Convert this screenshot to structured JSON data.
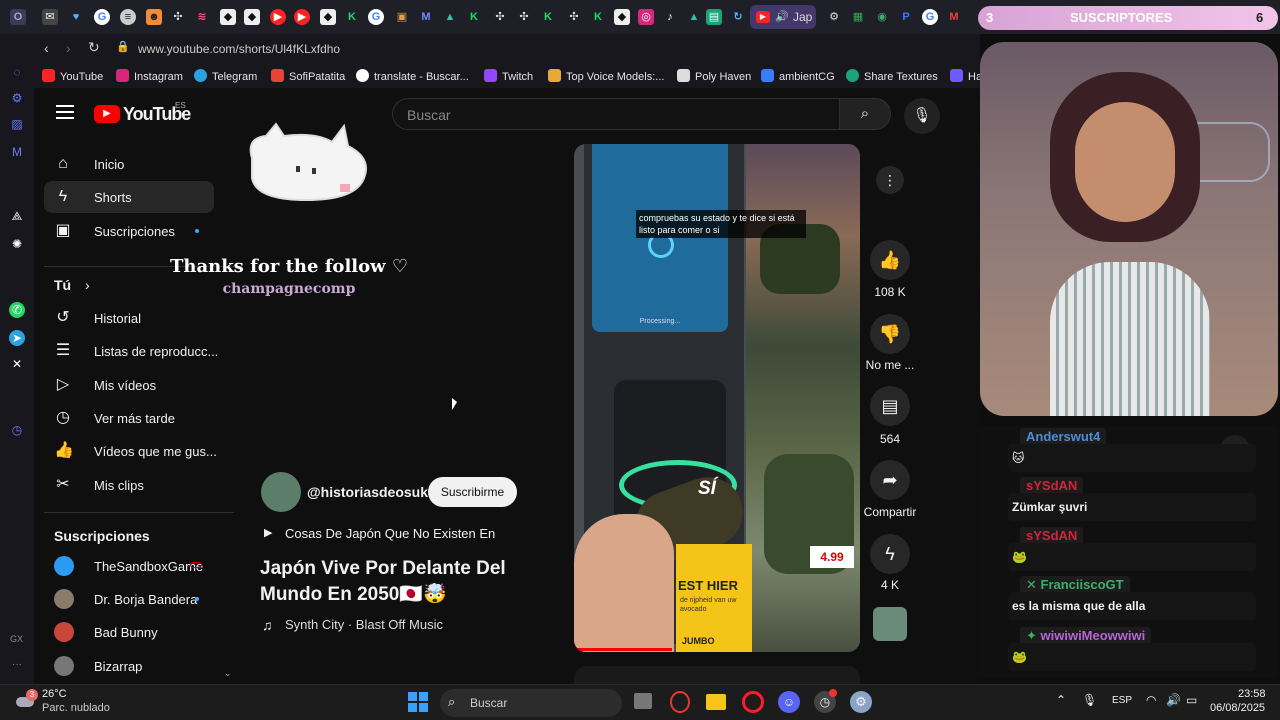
{
  "browser": {
    "url": "www.youtube.com/shorts/Ul4fKLxfdho",
    "active_tab_label": "Jap",
    "bookmarks": [
      "YouTube",
      "Instagram",
      "Telegram",
      "SofiPatatita",
      "translate - Buscar...",
      "Twitch",
      "Top Voice Models:...",
      "Poly Haven",
      "ambientCG",
      "Share Textures",
      "Ha"
    ]
  },
  "youtube": {
    "logo_text": "YouTube",
    "region": "ES",
    "search_placeholder": "Buscar",
    "nav": [
      "Inicio",
      "Shorts",
      "Suscripciones"
    ],
    "you_section": "Tú",
    "you_items": [
      "Historial",
      "Listas de reproducc...",
      "Mis vídeos",
      "Ver más tarde",
      "Vídeos que me gus...",
      "Mis clips"
    ],
    "subscriptions_header": "Suscripciones",
    "subscriptions": [
      "TheSandboxGame",
      "Dr. Borja Bandera",
      "Bad Bunny",
      "Bizarrap"
    ],
    "short": {
      "channel": "@historiasdeosuke",
      "subscribe_label": "Suscribirme",
      "playlist": "Cosas De Japón Que No Existen En",
      "title": "Japón Vive Por Delante Del Mundo En 2050🇯🇵🤯",
      "music": "Synth City · Blast Off Music",
      "caption": "compruebas su estado y te dice si está listo para comer o si",
      "screen_text": "Processing...",
      "sticker_yes": "SÍ",
      "sign_text_1": "EST HIER",
      "sign_text_2": "de rijpheid van uw avocado",
      "brand": "JUMBO",
      "price": "4.99"
    },
    "actions": {
      "likes": "108 K",
      "dislike": "No me ...",
      "comments": "564",
      "share": "Compartir",
      "remix": "4 K"
    }
  },
  "overlay": {
    "follow_text": "Thanks for the follow ♡",
    "follower": "champagnecomp"
  },
  "stream": {
    "subs_count": "3",
    "subs_label": "SUSCRIPTORES",
    "subs_right": "6",
    "chat": [
      {
        "name": "Anderswut4",
        "message": "🐱",
        "color": "#4e8dd6"
      },
      {
        "name": "sYSdAN",
        "message": "Zümkar şuvri",
        "color": "#d4243b"
      },
      {
        "name": "sYSdAN",
        "message": "🐸",
        "color": "#d4243b"
      },
      {
        "name": "FranciiscoGT",
        "message": "es la misma que de alla",
        "color": "#3fae6b"
      },
      {
        "name": "wiwiwiMeowwiwi",
        "message": "🐸",
        "color": "#b565d6"
      }
    ]
  },
  "taskbar": {
    "weather_temp": "26°C",
    "weather_desc": "Parc. nublado",
    "search_label": "Buscar",
    "lang": "ESP",
    "time": "23:58",
    "date": "06/08/2025"
  }
}
